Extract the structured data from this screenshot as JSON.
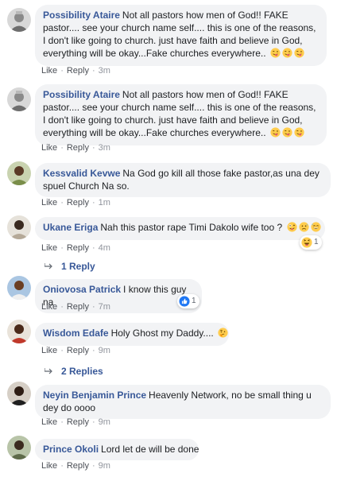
{
  "action_labels": {
    "like": "Like",
    "reply": "Reply",
    "separator": "·"
  },
  "comments": [
    {
      "author": "Possibility Ataire",
      "text": "Not all pastors how men of God!! FAKE pastor.... see your church name self.... this is one of the reasons, I don't like going to church. just have faith and believe in God, everything will be okay...Fake churches everywhere..",
      "emoji": [
        "tongue-wink",
        "tongue-wink",
        "tongue-wink"
      ],
      "time": "3m"
    },
    {
      "author": "Possibility Ataire",
      "text": "Not all pastors how men of God!! FAKE pastor.... see your church name self.... this is one of the reasons, I don't like going to church. just have faith and believe in God, everything will be okay...Fake churches everywhere..",
      "emoji": [
        "tongue-wink",
        "tongue-wink",
        "tongue-wink"
      ],
      "time": "3m"
    },
    {
      "author": "Kessvalid Kevwe",
      "text": "Na God go kill all those fake pastor,as una dey spuel Church Na so.",
      "time": "1m"
    },
    {
      "author": "Ukane Eriga",
      "text": "Nah this pastor rape Timi Dakolo wife too ?",
      "emoji": [
        "zany",
        "disappointed-relieved",
        "grin-sweat"
      ],
      "time": "4m",
      "reaction": {
        "icon": "haha-icon",
        "count": "1"
      },
      "replies": "1 Reply"
    },
    {
      "author": "Oniovosa Patrick",
      "text": "I know this guy na",
      "time": "7m",
      "reaction": {
        "icon": "like-icon",
        "count": "1"
      }
    },
    {
      "author": "Wisdom Edafe",
      "text": "Holy Ghost my Daddy....",
      "emoji": [
        "thinking"
      ],
      "time": "9m",
      "replies": "2 Replies"
    },
    {
      "author": "Neyin Benjamin Prince",
      "text": "Heavenly Network, no be small thing u dey do oooo",
      "time": "9m"
    },
    {
      "author": "Prince Okoli",
      "text": "Lord let de will be done",
      "time": "9m"
    }
  ],
  "colors": {
    "author": "#385898",
    "bubble": "#f2f3f5",
    "meta": "#90949c",
    "like_blue": "#2078f4",
    "emoji_yellow": "#ffcc4d"
  }
}
